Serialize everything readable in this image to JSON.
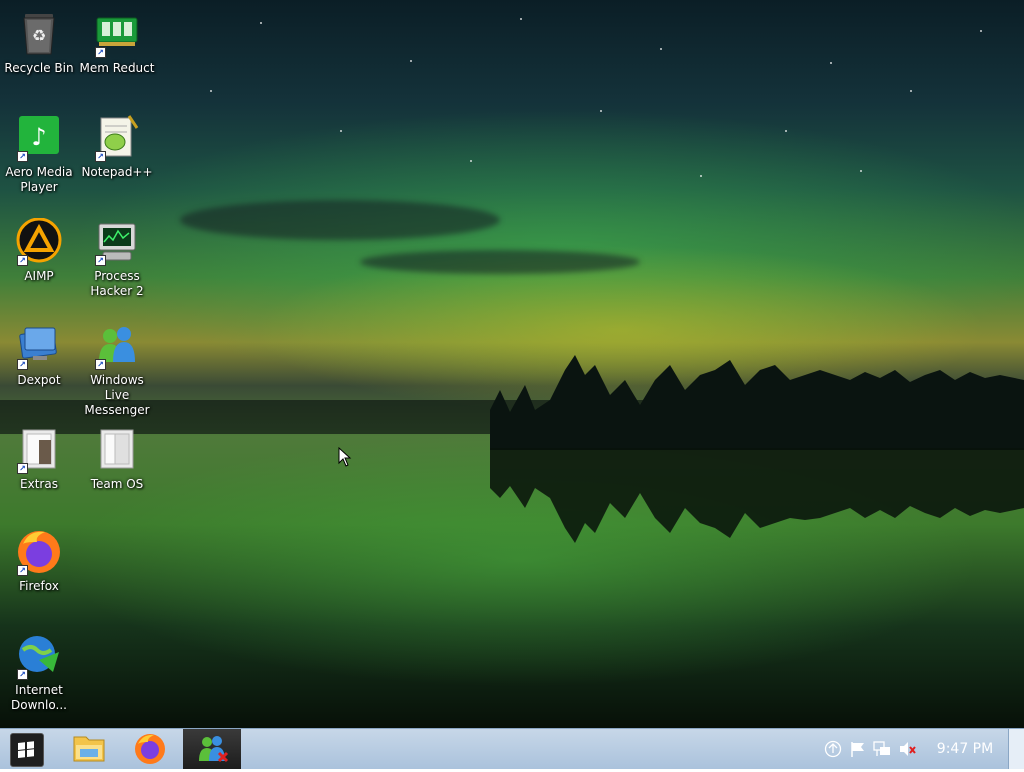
{
  "desktop": {
    "icons": [
      {
        "label": "Recycle Bin",
        "icon": "recycle-bin-icon"
      },
      {
        "label": "Mem Reduct",
        "icon": "memory-icon"
      },
      {
        "label": "Aero Media Player",
        "icon": "music-note-icon"
      },
      {
        "label": "Notepad++",
        "icon": "notepad-plus-plus-icon"
      },
      {
        "label": "AIMP",
        "icon": "aimp-icon"
      },
      {
        "label": "Process Hacker 2",
        "icon": "process-hacker-icon"
      },
      {
        "label": "Dexpot",
        "icon": "dexpot-icon"
      },
      {
        "label": "Windows Live Messenger",
        "icon": "messenger-icon"
      },
      {
        "label": "Extras",
        "icon": "folder-icon"
      },
      {
        "label": "Team OS",
        "icon": "folder-icon"
      },
      {
        "label": "Firefox",
        "icon": "firefox-icon"
      },
      {
        "label": "Internet Downlo...",
        "icon": "internet-download-manager-icon"
      }
    ]
  },
  "taskbar": {
    "start": {
      "icon": "windows-logo-icon"
    },
    "pinned": [
      {
        "name": "File Explorer",
        "icon": "file-explorer-icon"
      },
      {
        "name": "Firefox",
        "icon": "firefox-icon"
      },
      {
        "name": "Windows Live Messenger",
        "icon": "messenger-icon"
      }
    ],
    "tray": [
      {
        "icon": "upload-arrow-icon"
      },
      {
        "icon": "action-center-flag-icon"
      },
      {
        "icon": "network-icon"
      },
      {
        "icon": "volume-muted-icon"
      }
    ],
    "clock": "9:47 PM"
  },
  "colors": {
    "taskbar": "#aac2dc",
    "firefox_orange": "#ff7a1a",
    "firefox_purple": "#7b3ee0"
  }
}
